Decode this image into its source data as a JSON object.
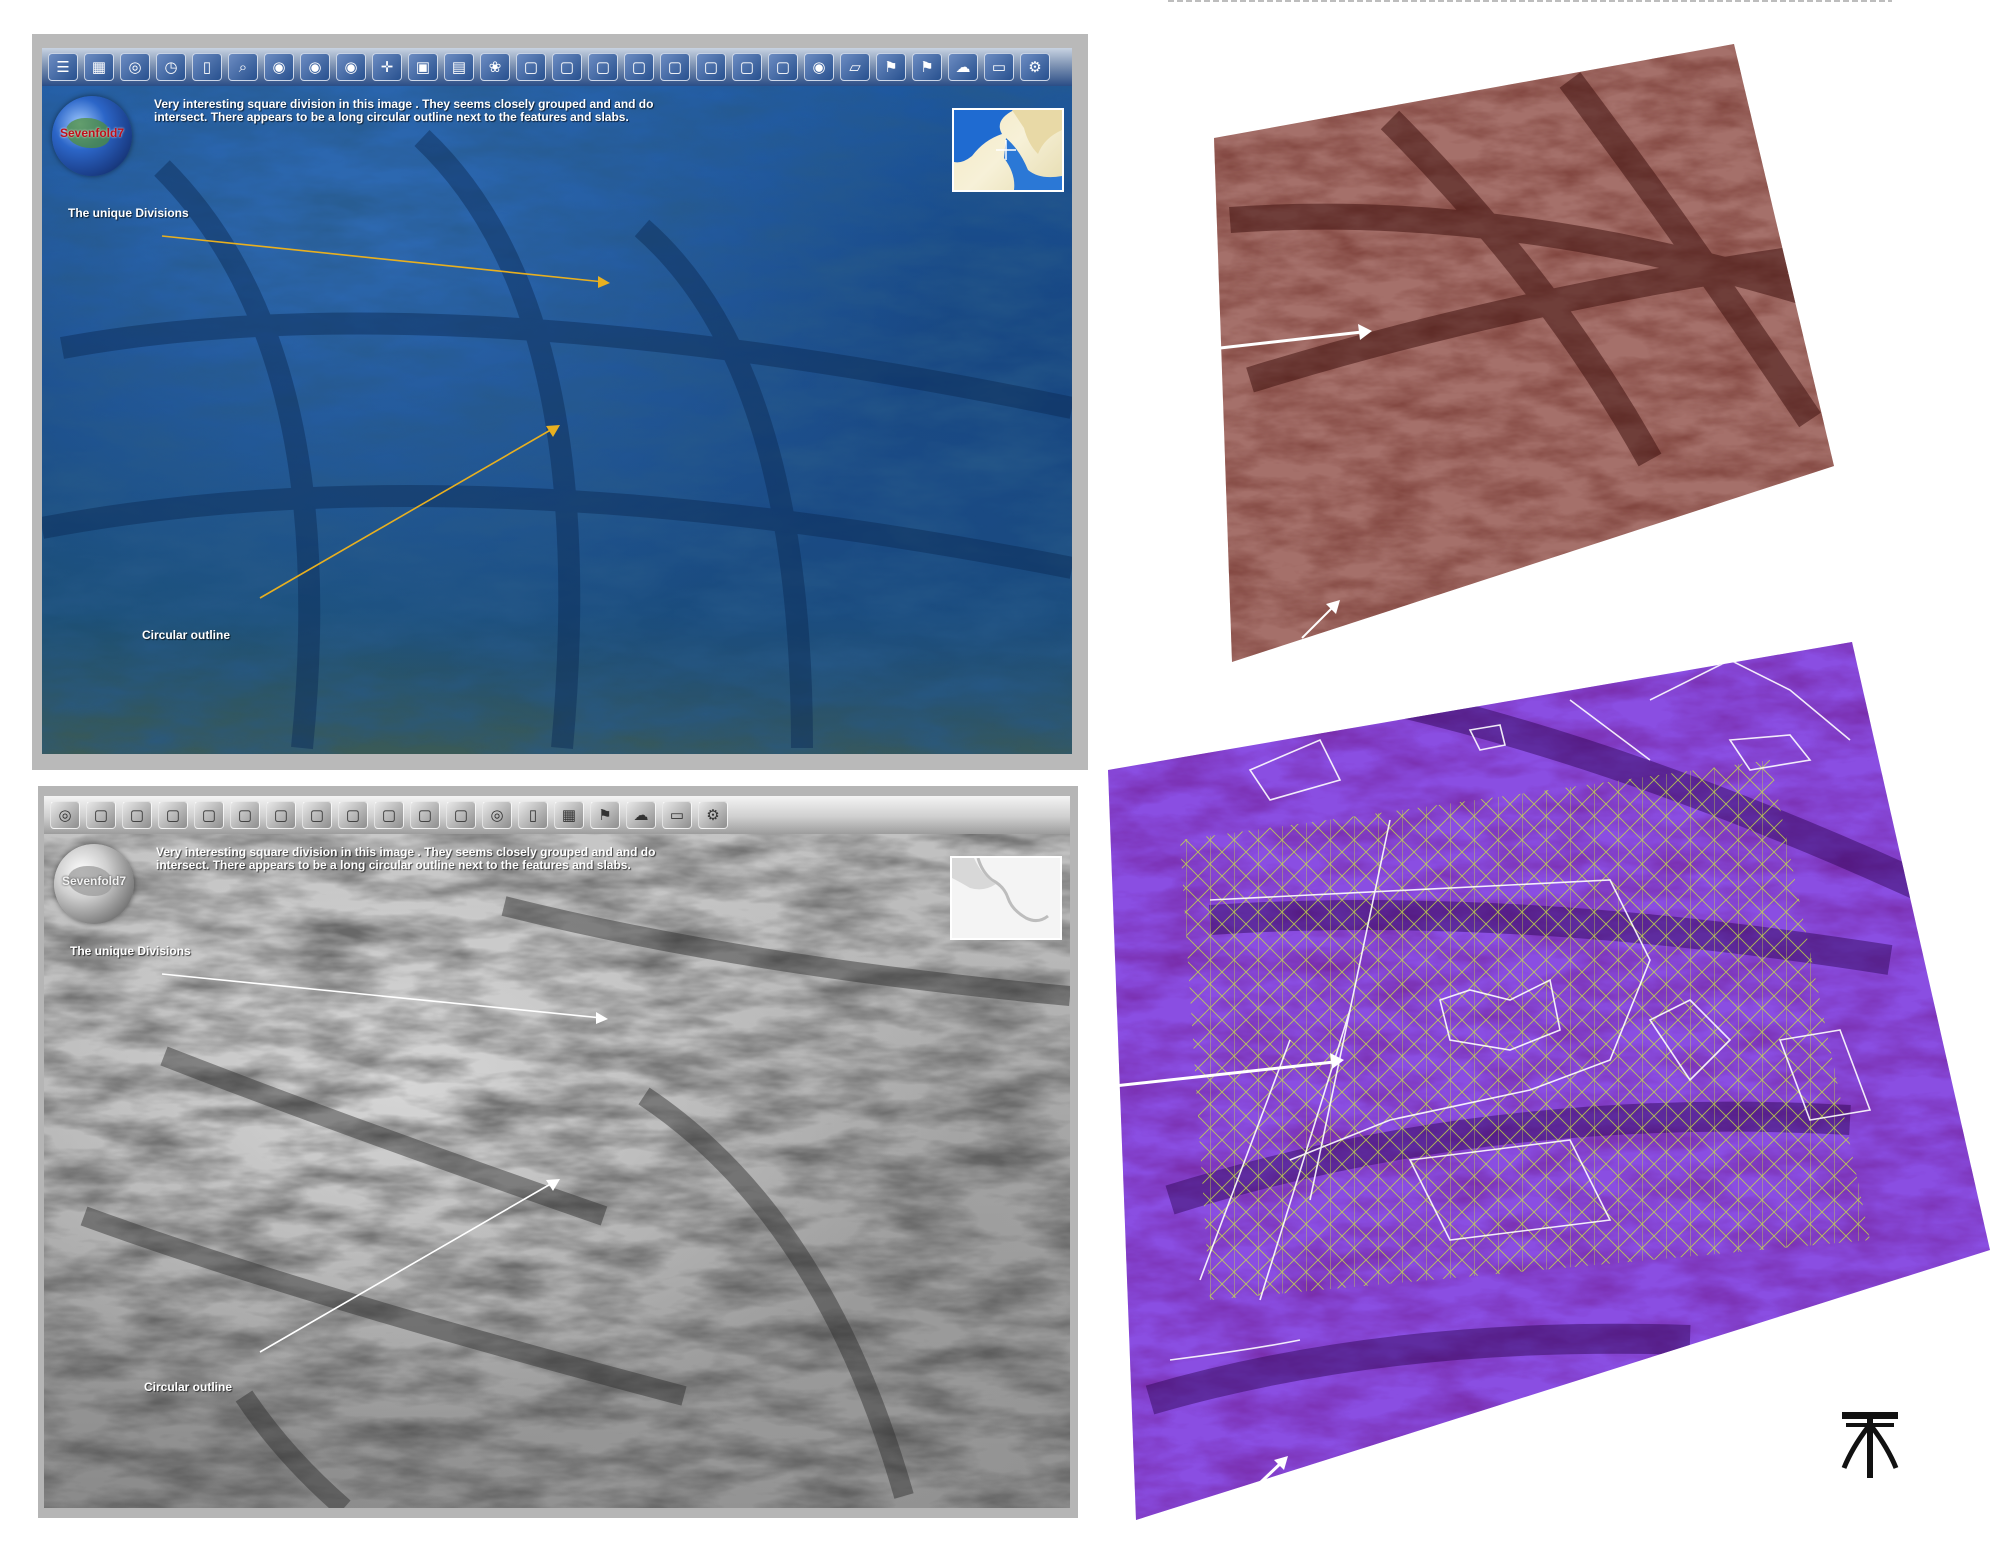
{
  "toolbar": {
    "buttons_top": [
      "layers-icon",
      "grid-icon",
      "globe-icon",
      "clock-icon",
      "document-icon",
      "zoom-icon",
      "earth-icon",
      "earth-icon",
      "earth-icon",
      "move-icon",
      "camera-icon",
      "chart-icon",
      "color-wheel-icon",
      "window-icon",
      "window-icon",
      "window-icon",
      "window-icon",
      "window-icon",
      "window-icon",
      "window-icon",
      "window-icon",
      "earth-icon",
      "map-icon",
      "flag-icon",
      "flag-icon",
      "weather-icon",
      "us-map-icon",
      "settings-icon"
    ],
    "buttons_bottom": [
      "globe-icon",
      "window-icon",
      "window-icon",
      "window-icon",
      "window-icon",
      "window-icon",
      "window-icon",
      "window-icon",
      "window-icon",
      "window-icon",
      "window-icon",
      "window-icon",
      "globe-icon",
      "document-icon",
      "grid-icon",
      "flag-icon",
      "weather-icon",
      "us-map-icon",
      "settings-icon"
    ]
  },
  "logo": {
    "label": "Sevenfold7"
  },
  "caption": "Very interesting square division in this image .  They seems closely grouped and and do intersect.  There appears to be a long circular outline next to the features and slabs.",
  "labels": {
    "divisions": "The unique Divisions",
    "circular": "Circular outline"
  },
  "colors": {
    "blue_view": "#1b4f8f",
    "gray_view": "#a8a8a8",
    "brown_view": "#7a3e36",
    "purple_view": "#6b2bc9",
    "annotation_yellow": "#e8b020",
    "overlay_grid": "#c8e640"
  }
}
